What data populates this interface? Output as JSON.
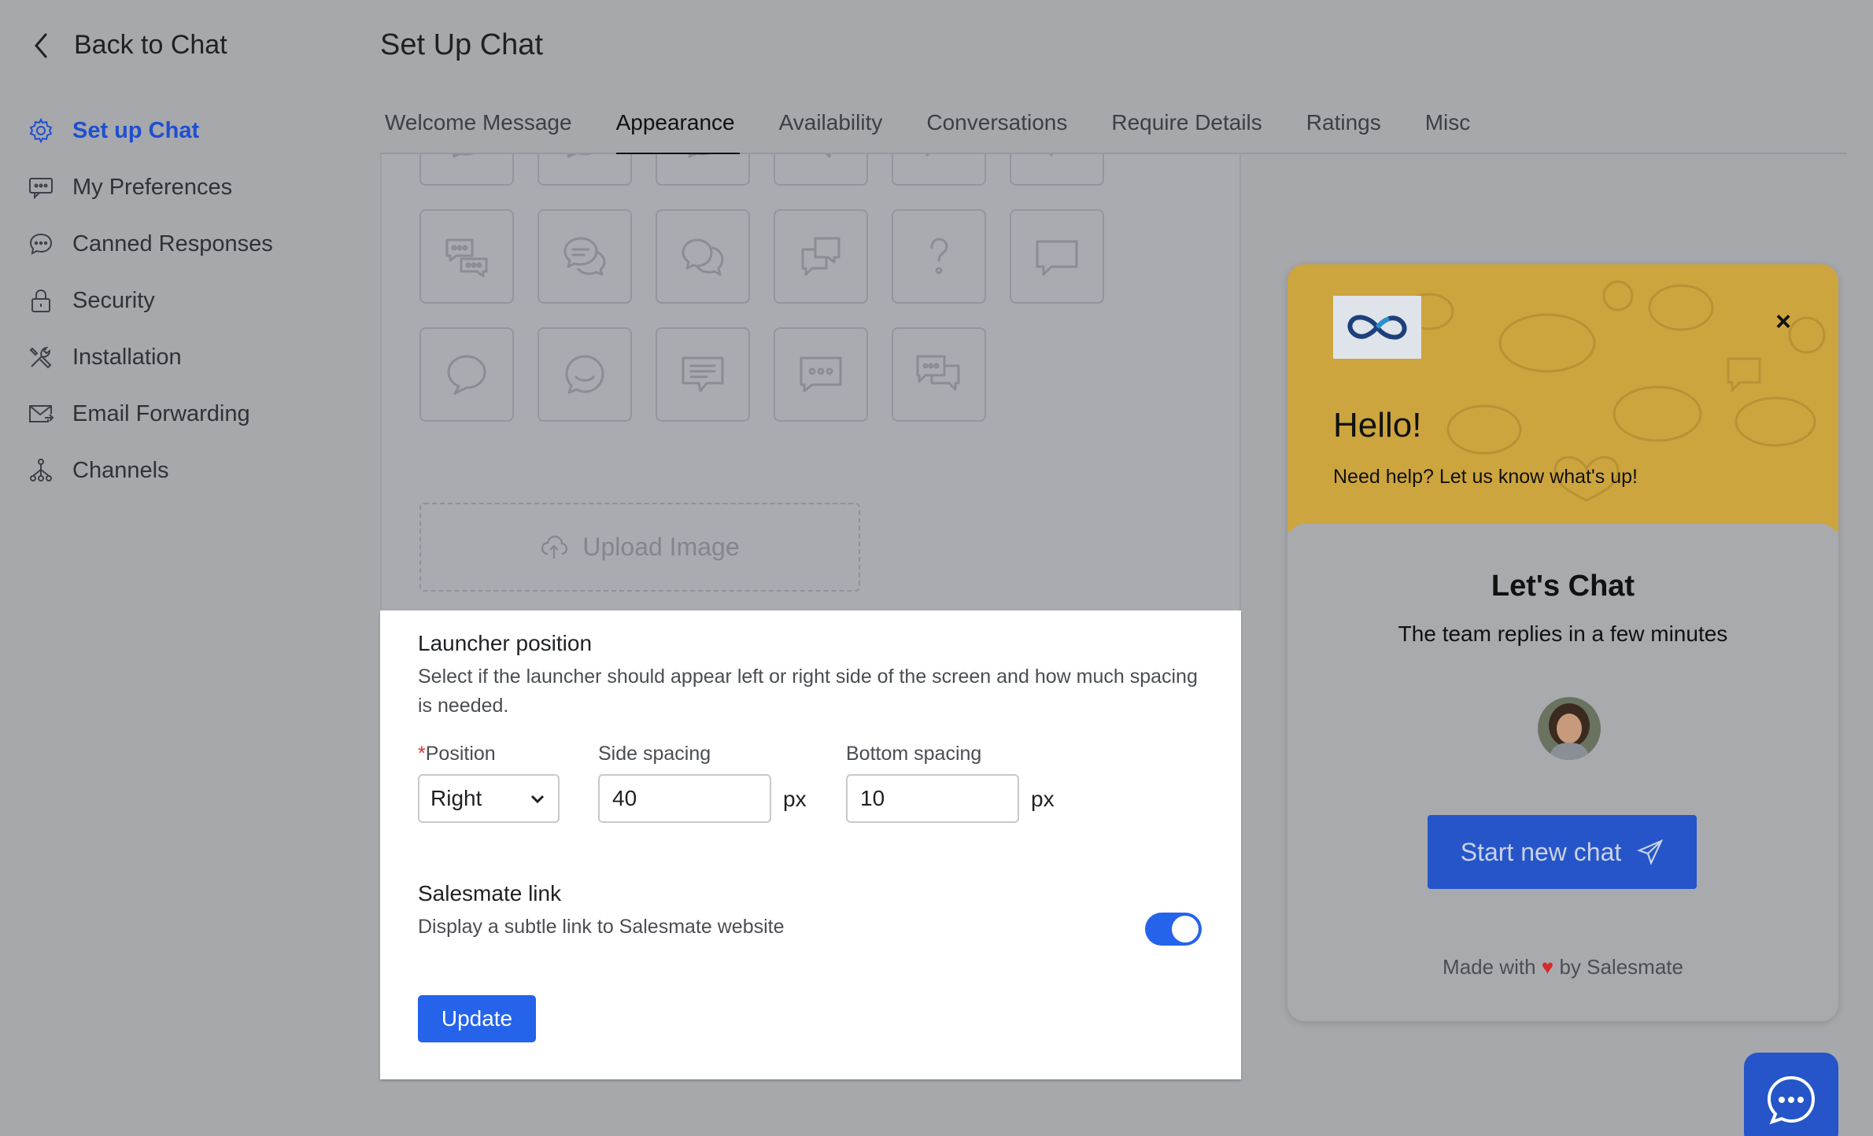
{
  "sidebar": {
    "back_label": "Back to Chat",
    "items": [
      {
        "label": "Set up Chat",
        "icon": "gear-icon"
      },
      {
        "label": "My Preferences",
        "icon": "preferences-icon"
      },
      {
        "label": "Canned Responses",
        "icon": "chat-bubble-icon"
      },
      {
        "label": "Security",
        "icon": "lock-icon"
      },
      {
        "label": "Installation",
        "icon": "tools-icon"
      },
      {
        "label": "Email Forwarding",
        "icon": "mail-forward-icon"
      },
      {
        "label": "Channels",
        "icon": "channels-icon"
      }
    ]
  },
  "header": {
    "title": "Set Up Chat",
    "tabs": [
      "Welcome Message",
      "Appearance",
      "Availability",
      "Conversations",
      "Require Details",
      "Ratings",
      "Misc"
    ],
    "active_tab": "Appearance"
  },
  "appearance": {
    "upload_label": "Upload Image"
  },
  "launcher_position": {
    "title": "Launcher position",
    "description": "Select if the launcher should appear left or right side of the screen and how much spacing is needed.",
    "position_label": "Position",
    "required_mark": "*",
    "position_value": "Right",
    "side_spacing_label": "Side spacing",
    "side_spacing_value": "40",
    "bottom_spacing_label": "Bottom spacing",
    "bottom_spacing_value": "10",
    "unit": "px"
  },
  "salesmate_link": {
    "title": "Salesmate link",
    "description": "Display a subtle link to Salesmate website",
    "enabled": true
  },
  "update_label": "Update",
  "preview": {
    "close": "×",
    "greeting": "Hello!",
    "help_text": "Need help? Let us know what's up!",
    "chat_title": "Let's Chat",
    "chat_subtitle": "The team replies in a few minutes",
    "start_button": "Start new chat",
    "made_with_prefix": "Made with",
    "made_with_heart": "♥",
    "made_with_suffix": "by Salesmate",
    "header_color": "#cda53e",
    "button_color": "#2555c9"
  },
  "colors": {
    "accent": "#2563eb",
    "active_nav": "#1f4fcf",
    "overlay_bg": "#a6a8ac"
  }
}
